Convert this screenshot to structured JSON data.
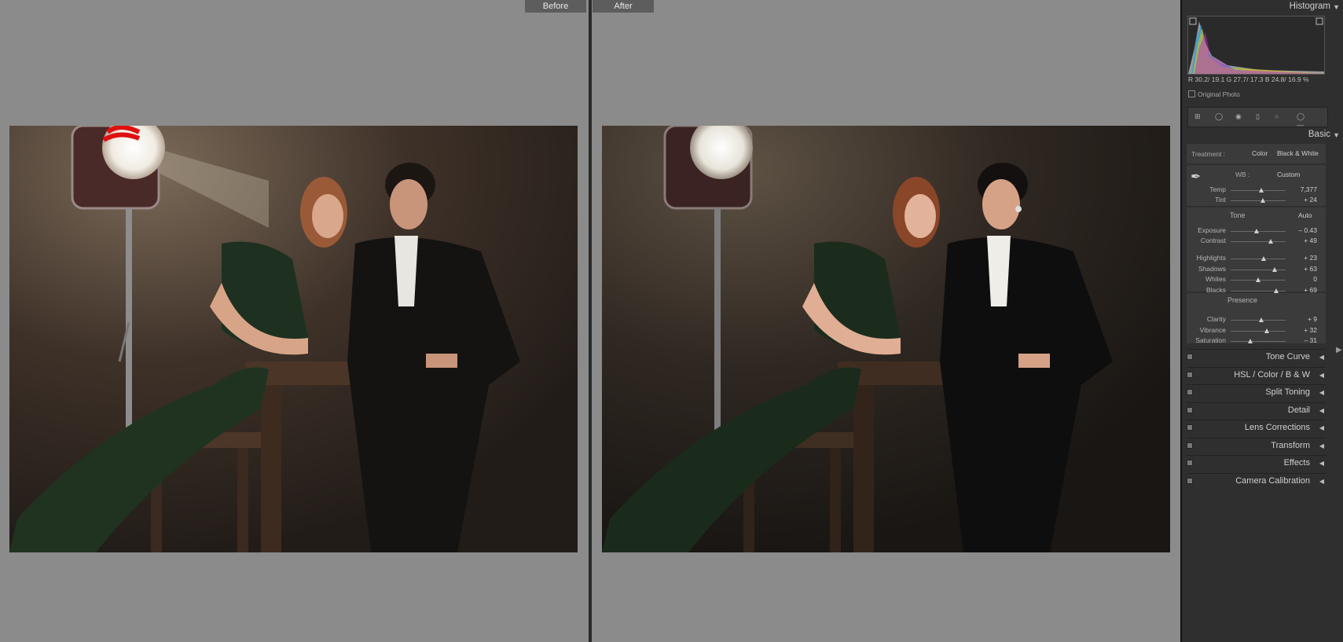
{
  "compare": {
    "before_label": "Before",
    "after_label": "After"
  },
  "panel": {
    "histogram_title": "Histogram",
    "rgb": "R 30.2/ 19.1  G 27.7/ 17.3  B 24.8/ 16.9 %",
    "original_photo": "Original Photo",
    "basic_title": "Basic",
    "treatment_label": "Treatment :",
    "treatment_color": "Color",
    "treatment_bw": "Black & White",
    "wb_label": "WB :",
    "wb_value": "Custom",
    "wb_rows": [
      {
        "label": "Temp",
        "value": "7,377",
        "pos": 0.55
      },
      {
        "label": "Tint",
        "value": "+ 24",
        "pos": 0.58
      }
    ],
    "tone_label": "Tone",
    "auto_label": "Auto",
    "tone_rows": [
      {
        "label": "Exposure",
        "value": "– 0.43",
        "pos": 0.47
      },
      {
        "label": "Contrast",
        "value": "+ 49",
        "pos": 0.73
      }
    ],
    "tone_rows2": [
      {
        "label": "Highlights",
        "value": "+ 23",
        "pos": 0.6
      },
      {
        "label": "Shadows",
        "value": "+ 63",
        "pos": 0.8
      },
      {
        "label": "Whites",
        "value": "0",
        "pos": 0.5
      },
      {
        "label": "Blacks",
        "value": "+ 69",
        "pos": 0.83
      }
    ],
    "presence_label": "Presence",
    "presence_rows": [
      {
        "label": "Clarity",
        "value": "+ 9",
        "pos": 0.55
      },
      {
        "label": "Vibrance",
        "value": "+ 32",
        "pos": 0.66
      },
      {
        "label": "Saturation",
        "value": "– 31",
        "pos": 0.35
      }
    ],
    "collapsed_sections": [
      "Tone Curve",
      "HSL  /  Color  /  B & W",
      "Split Toning",
      "Detail",
      "Lens Corrections",
      "Transform",
      "Effects",
      "Camera Calibration"
    ]
  }
}
